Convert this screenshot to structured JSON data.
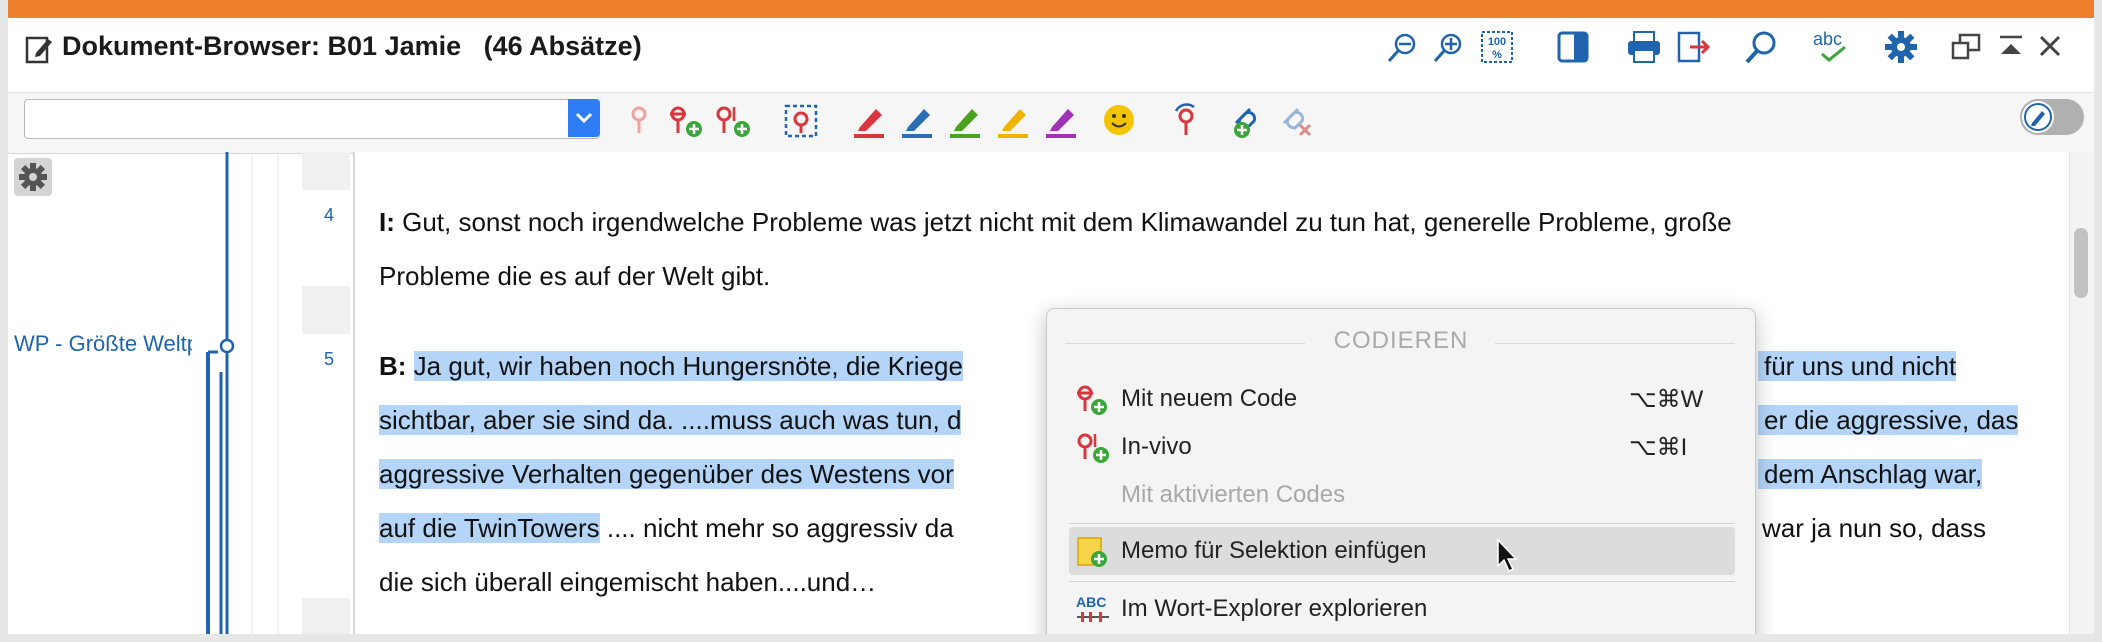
{
  "window": {
    "title": "Dokument-Browser: B01 Jamie",
    "paragraph_count": "(46 Absätze)"
  },
  "titlebar_icons": [
    "edit-document-icon",
    "zoom-out-icon",
    "zoom-in-icon",
    "zoom-100-icon",
    "sidebar-toggle-icon",
    "print-icon",
    "export-icon",
    "search-icon",
    "spellcheck-icon",
    "settings-gear-icon",
    "restore-window-icon",
    "collapse-up-icon",
    "close-icon"
  ],
  "toolbar": {
    "code_select_value": "",
    "icons": [
      "code-pin-icon",
      "code-with-new-code-icon",
      "code-invivo-icon",
      "select-area-icon",
      "highlight-red-icon",
      "highlight-blue-icon",
      "highlight-green-icon",
      "highlight-yellow-icon",
      "highlight-purple-icon",
      "emoticon-icon",
      "recode-icon",
      "link-add-icon",
      "link-remove-icon"
    ]
  },
  "sidebar": {
    "code_label": "WP - Größte Weltprobleme"
  },
  "paragraphs": [
    {
      "number": "4",
      "speaker": "I:",
      "line1": " Gut, sonst noch irgendwelche Probleme was jetzt nicht mit dem Klimawandel zu tun hat, generelle Probleme, große",
      "line2": "Probleme die es auf der Welt gibt."
    },
    {
      "number": "5",
      "speaker": "B:",
      "l1_hl": "Ja gut, wir haben noch Hungersnöte, die Kriege",
      "l1_right_hl": "für uns und nicht",
      "l2_hl": "sichtbar, aber sie sind da. ....muss auch was tun, d",
      "l2_right_hl": "er die aggressive, das",
      "l3_hl": "aggressive Verhalten gegenüber des Westens vor",
      "l3_right_hl": "dem Anschlag war,",
      "l4_hl": "auf die TwinTowers",
      "l4_plain": " .... nicht mehr so aggressiv da",
      "l4_right": "war ja nun so, dass",
      "l5": "die sich überall eingemischt haben....und…"
    }
  ],
  "context_menu": {
    "header": "CODIEREN",
    "items": [
      {
        "label": "Mit neuem Code",
        "shortcut": "⌥⌘W"
      },
      {
        "label": "In-vivo",
        "shortcut": "⌥⌘I"
      },
      {
        "label": "Mit aktivierten Codes",
        "shortcut": ""
      },
      {
        "label": "Memo für Selektion einfügen",
        "shortcut": ""
      },
      {
        "label": "Im Wort-Explorer explorieren",
        "shortcut": ""
      }
    ]
  },
  "colors": {
    "accent_orange": "#f07f2e",
    "selection_blue": "#b4d5f8",
    "link_blue": "#1f64ad",
    "code_red": "#d9363e"
  }
}
